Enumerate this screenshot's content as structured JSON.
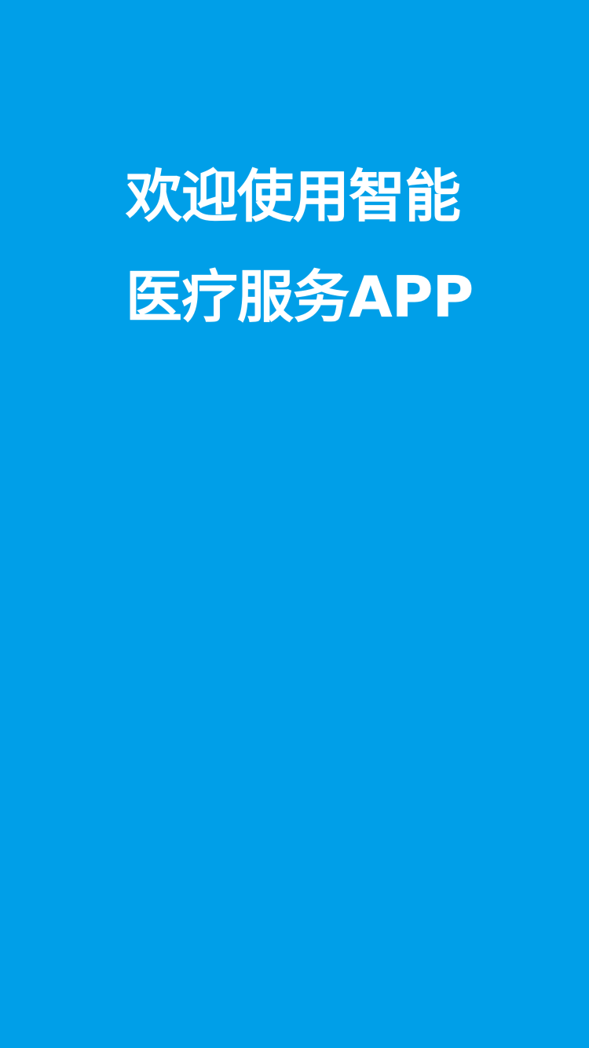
{
  "splash": {
    "background_color": "#009fe8",
    "text_color": "#ffffff",
    "title_line_1": "欢迎使用智能",
    "title_line_2": "医疗服务APP"
  }
}
